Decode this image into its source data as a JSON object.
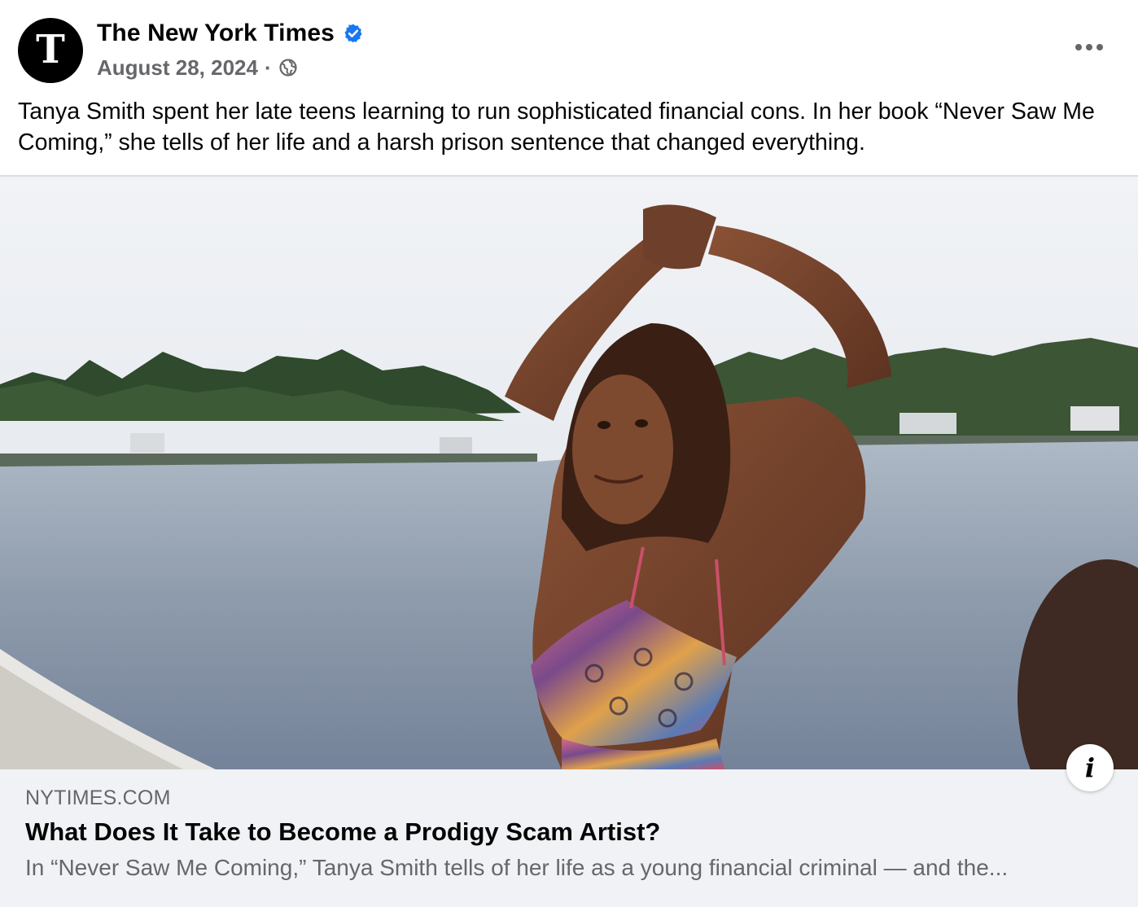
{
  "header": {
    "avatar_glyph": "T",
    "page_name": "The New York Times",
    "verified": true,
    "date": "August 28, 2024",
    "separator": "·",
    "audience_icon": "globe-icon"
  },
  "caption": "Tanya Smith spent her late teens learning to run sophisticated financial cons. In her book “Never Saw Me Coming,” she tells of her life and a harsh prison sentence that changed everything.",
  "link_preview": {
    "domain": "NYTIMES.COM",
    "title": "What Does It Take to Become a Prodigy Scam Artist?",
    "description": "In “Never Saw Me Coming,” Tanya Smith tells of her life as a young financial criminal — and the..."
  },
  "icons": {
    "more": "more-options-icon",
    "info": "info-icon",
    "verified": "verified-badge-icon"
  },
  "colors": {
    "verified_blue": "#1877f2",
    "secondary_text": "#65676b",
    "preview_bg": "#f0f2f5"
  }
}
